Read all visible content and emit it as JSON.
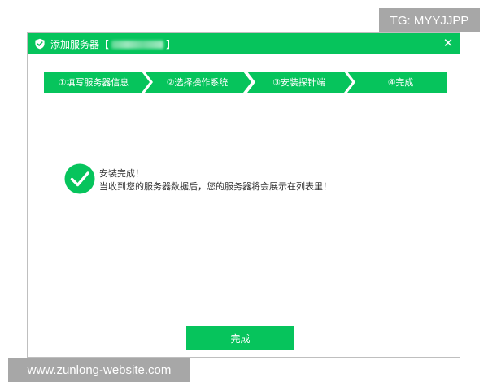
{
  "dialog": {
    "title_prefix": "添加服务器【",
    "title_suffix": "】",
    "close_glyph": "✕",
    "accent_color": "#06c45c"
  },
  "steps": [
    {
      "label": "①填写服务器信息"
    },
    {
      "label": "②选择操作系统"
    },
    {
      "label": "③安装探针端"
    },
    {
      "label": "④完成"
    }
  ],
  "message": {
    "icon": "check-circle-icon",
    "line1": "安装完成！",
    "line2": "当收到您的服务器数据后，您的服务器将会展示在列表里！"
  },
  "footer": {
    "done_label": "完成"
  },
  "overlays": {
    "tg": "TG: MYYJJPP",
    "site": "www.zunlong-website.com"
  }
}
